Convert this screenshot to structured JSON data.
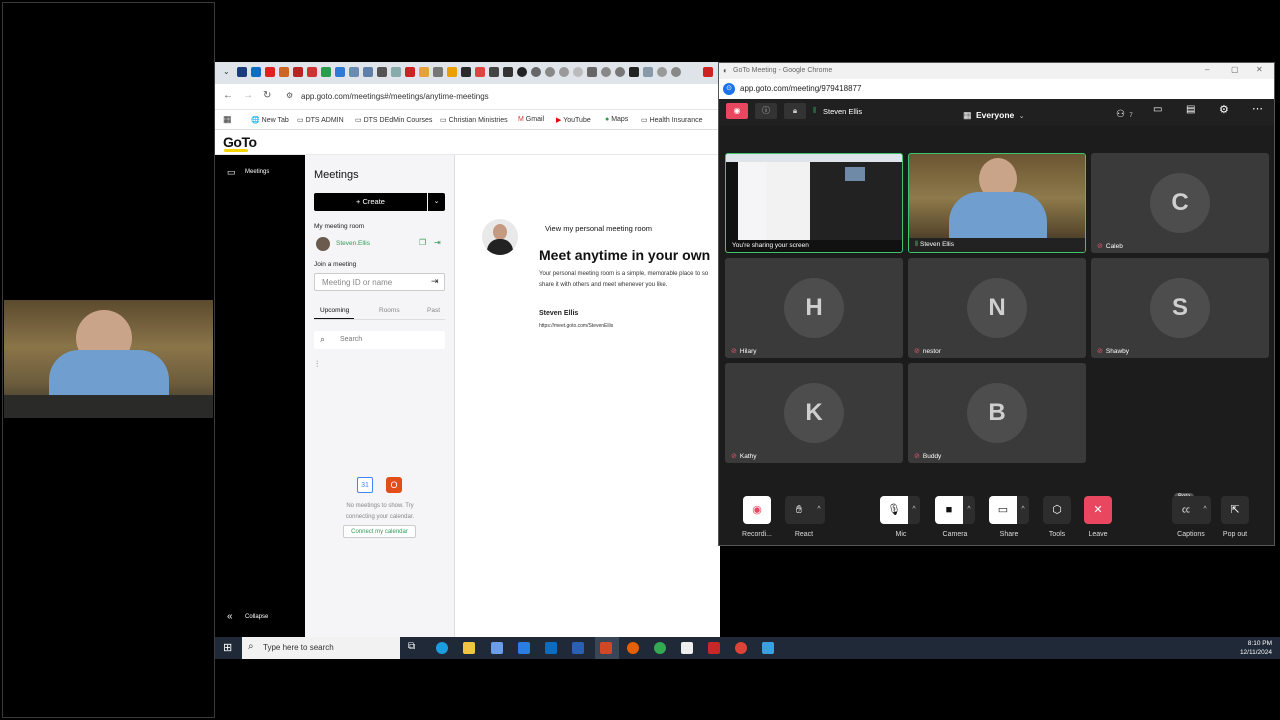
{
  "browser": {
    "url": "app.goto.com/meetings#/meetings/anytime-meetings",
    "bookmarks": [
      "New Tab",
      "DTS ADMIN",
      "DTS DEdMin Courses",
      "Christian Ministries",
      "Gmail",
      "YouTube",
      "Maps",
      "Health Insurance"
    ]
  },
  "goto": {
    "logo": "GoTo",
    "nav": {
      "meetings": "Meetings",
      "collapse": "Collapse"
    },
    "meetings_title": "Meetings",
    "create_label": "Create",
    "my_room_label": "My meeting room",
    "room_user": "Steven.Ellis",
    "join_label": "Join a meeting",
    "join_placeholder": "Meeting ID or name",
    "tabs": [
      "Upcoming",
      "Rooms",
      "Past"
    ],
    "search_placeholder": "Search",
    "empty_text": "No meetings to show. Try connecting your calendar.",
    "connect_label": "Connect my calendar",
    "view_room_link": "View my personal meeting room",
    "headline": "Meet anytime in your own",
    "desc": "Your personal meeting room is a simple, memorable place to so share it with others and meet whenever you like.",
    "owner_name": "Steven Ellis",
    "owner_link": "https://meet.goto.com/StevenEllis"
  },
  "meeting_window": {
    "title": "GoTo Meeting - Google Chrome",
    "url": "app.goto.com/meeting/979418877",
    "host": "Steven Ellis",
    "view": "Everyone",
    "participant_count": "7",
    "tiles": [
      {
        "name": "You're sharing your screen",
        "type": "screen"
      },
      {
        "name": "Steven Ellis",
        "type": "video"
      },
      {
        "name": "Caleb",
        "initial": "C"
      },
      {
        "name": "Hilary",
        "initial": "H"
      },
      {
        "name": "nestor",
        "initial": "N"
      },
      {
        "name": "Shawby",
        "initial": "S"
      },
      {
        "name": "Kathy",
        "initial": "K"
      },
      {
        "name": "Buddy",
        "initial": "B"
      }
    ],
    "controls": {
      "record": "Recordi...",
      "react": "React",
      "mic": "Mic",
      "camera": "Camera",
      "share": "Share",
      "tools": "Tools",
      "leave": "Leave",
      "captions": "Captions",
      "captions_badge": "Beta",
      "popout": "Pop out"
    }
  },
  "taskbar": {
    "search_placeholder": "Type here to search",
    "time": "8:10 PM",
    "date": "12/11/2024"
  },
  "colors": {
    "leave": "#e8475f",
    "record": "#e8475f",
    "accent_green": "#2e9c58",
    "goto_yellow": "#f5d400"
  }
}
